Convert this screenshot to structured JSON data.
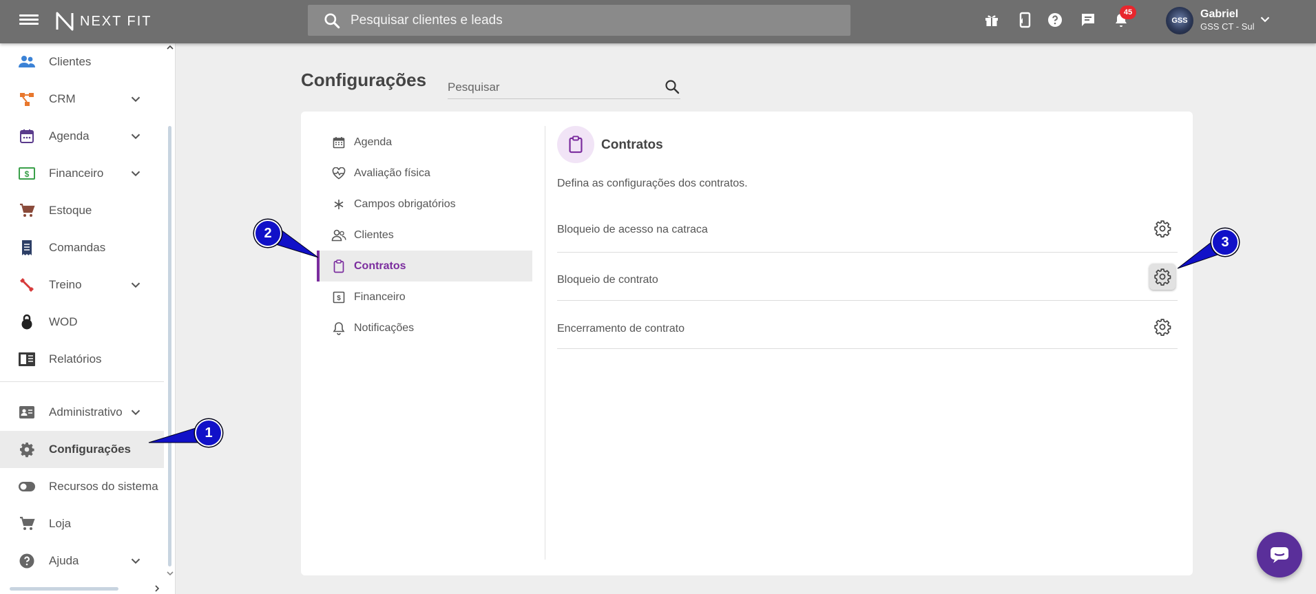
{
  "app": {
    "brand": "NEXT FIT"
  },
  "topbar": {
    "search_placeholder": "Pesquisar clientes e leads",
    "notifications_count": "45",
    "user": {
      "name": "Gabriel",
      "org": "GSS CT - Sul",
      "avatar_text": "GSS"
    },
    "icons": [
      "gift-icon",
      "mobile-phone-icon",
      "help-icon",
      "chat-icon",
      "bell-icon"
    ]
  },
  "sidebar": {
    "items": [
      {
        "label": "Clientes",
        "icon": "users-icon",
        "expandable": false
      },
      {
        "label": "CRM",
        "icon": "crm-icon",
        "expandable": true
      },
      {
        "label": "Agenda",
        "icon": "calendar-icon",
        "expandable": true
      },
      {
        "label": "Financeiro",
        "icon": "money-icon",
        "expandable": true
      },
      {
        "label": "Estoque",
        "icon": "cart-icon",
        "expandable": false
      },
      {
        "label": "Comandas",
        "icon": "receipt-icon",
        "expandable": false
      },
      {
        "label": "Treino",
        "icon": "dumbbell-icon",
        "expandable": true
      },
      {
        "label": "WOD",
        "icon": "kettlebell-icon",
        "expandable": false
      },
      {
        "label": "Relatórios",
        "icon": "report-icon",
        "expandable": false
      },
      {
        "label": "Administrativo",
        "icon": "id-card-icon",
        "expandable": true
      },
      {
        "label": "Configurações",
        "icon": "gear-icon",
        "expandable": false,
        "active": true
      },
      {
        "label": "Recursos do sistema",
        "icon": "toggle-icon",
        "expandable": false
      },
      {
        "label": "Loja",
        "icon": "cart-icon",
        "expandable": false
      },
      {
        "label": "Ajuda",
        "icon": "help-icon",
        "expandable": true
      }
    ]
  },
  "main": {
    "title": "Configurações",
    "search_placeholder": "Pesquisar",
    "menu": [
      {
        "label": "Agenda",
        "icon": "calendar-icon"
      },
      {
        "label": "Avaliação física",
        "icon": "heartbeat-icon"
      },
      {
        "label": "Campos obrigatórios",
        "icon": "asterisk-icon"
      },
      {
        "label": "Clientes",
        "icon": "users-icon"
      },
      {
        "label": "Contratos",
        "icon": "clipboard-icon",
        "active": true
      },
      {
        "label": "Financeiro",
        "icon": "money-icon"
      },
      {
        "label": "Notificações",
        "icon": "bell-icon"
      }
    ],
    "section": {
      "title": "Contratos",
      "description": "Defina as configurações dos contratos.",
      "rows": [
        {
          "label": "Bloqueio de acesso na catraca"
        },
        {
          "label": "Bloqueio de contrato",
          "highlighted": true
        },
        {
          "label": "Encerramento de contrato"
        }
      ]
    }
  },
  "annotations": [
    "1",
    "2",
    "3"
  ],
  "colors": {
    "topbar": "#6f6f6f",
    "accent": "#7b2d9e",
    "callout": "#1111c8",
    "badge": "#e8262d",
    "chat_button": "#5a2f9a"
  }
}
